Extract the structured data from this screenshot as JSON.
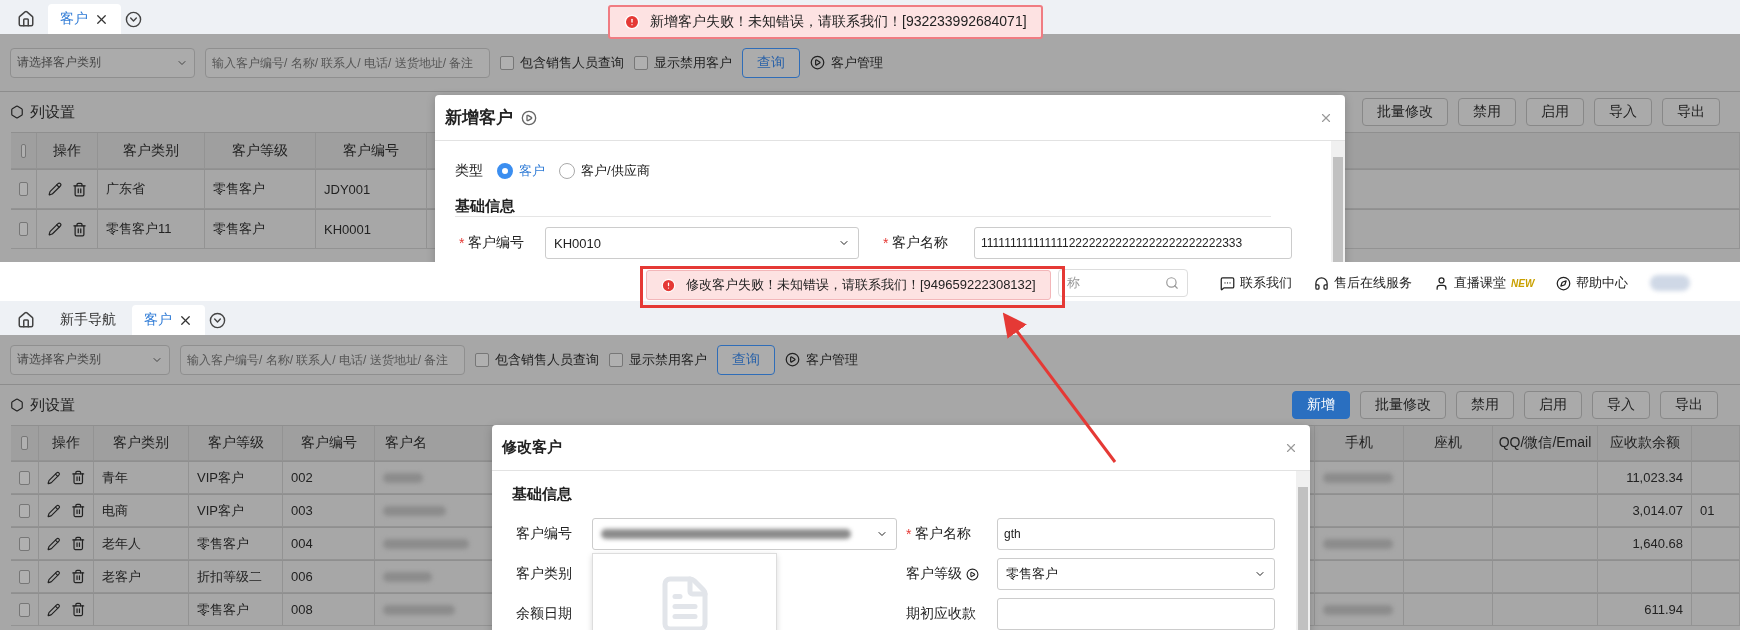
{
  "top_screen": {
    "tabs": [
      {
        "label": "客户",
        "selected": true,
        "closable": true
      }
    ],
    "toast": {
      "message": "新增客户失败！未知错误，请联系我们！[932233992684071]"
    },
    "filter": {
      "category_placeholder": "请选择客户类别",
      "search_placeholder": "输入客户编号/ 名称/ 联系人/ 电话/ 送货地址/ 备注",
      "checkboxes": [
        {
          "label": "包含销售人员查询",
          "checked": false
        },
        {
          "label": "显示禁用客户",
          "checked": false
        }
      ],
      "query_button": "查询",
      "manage_link": "客户管理"
    },
    "column_settings": "列设置",
    "actions": [
      {
        "label": "批量修改",
        "primary": false
      },
      {
        "label": "禁用",
        "primary": false
      },
      {
        "label": "启用",
        "primary": false
      },
      {
        "label": "导入",
        "primary": false
      },
      {
        "label": "导出",
        "primary": false
      }
    ],
    "table": {
      "select_all_checked": false,
      "columns": [
        "操作",
        "客户类别",
        "客户等级",
        "客户编号"
      ],
      "rows": [
        {
          "checked": false,
          "category": "广东省",
          "level": "零售客户",
          "code": "JDY001"
        },
        {
          "checked": false,
          "category": "零售客户11",
          "level": "零售客户",
          "code": "KH0001"
        }
      ]
    },
    "dialog": {
      "title": "新增客户",
      "type_label": "类型",
      "type_options": [
        {
          "label": "客户",
          "selected": true
        },
        {
          "label": "客户/供应商",
          "selected": false
        }
      ],
      "section": "基础信息",
      "fields": [
        {
          "label": "客户编号",
          "required_mark": "*",
          "kind": "select",
          "value": "KH0010"
        },
        {
          "label": "客户名称",
          "required_mark": "*",
          "kind": "input",
          "value": "11111111111111122222222222222222222222333"
        }
      ]
    }
  },
  "bottom_screen": {
    "header": {
      "search_placeholder": "称",
      "links": [
        {
          "label": "联系我们"
        },
        {
          "label": "售后在线服务"
        },
        {
          "label": "直播课堂",
          "badge": "NEW"
        },
        {
          "label": "帮助中心"
        }
      ]
    },
    "tabs": [
      {
        "label": "新手导航",
        "selected": false,
        "closable": false
      },
      {
        "label": "客户",
        "selected": true,
        "closable": true
      }
    ],
    "toast": {
      "message": "修改客户失败！未知错误，请联系我们！[949659222308132]"
    },
    "filter": {
      "category_placeholder": "请选择客户类别",
      "search_placeholder": "输入客户编号/ 名称/ 联系人/ 电话/ 送货地址/ 备注",
      "checkboxes": [
        {
          "label": "包含销售人员查询",
          "checked": false
        },
        {
          "label": "显示禁用客户",
          "checked": false
        }
      ],
      "query_button": "查询",
      "manage_link": "客户管理"
    },
    "column_settings": "列设置",
    "actions": [
      {
        "label": "新增",
        "primary": true
      },
      {
        "label": "批量修改",
        "primary": false
      },
      {
        "label": "禁用",
        "primary": false
      },
      {
        "label": "启用",
        "primary": false
      },
      {
        "label": "导入",
        "primary": false
      },
      {
        "label": "导出",
        "primary": false
      }
    ],
    "table": {
      "select_all_checked": false,
      "columns": [
        "操作",
        "客户类别",
        "客户等级",
        "客户编号",
        "客户名",
        "手机",
        "座机",
        "QQ/微信/Email",
        "应收款余额"
      ],
      "rows": [
        {
          "checked": false,
          "category": "青年",
          "level": "VIP客户",
          "code": "002",
          "balance": "11,023.34"
        },
        {
          "checked": false,
          "category": "电商",
          "level": "VIP客户",
          "code": "003",
          "balance": "3,014.07",
          "column_10": "01"
        },
        {
          "checked": false,
          "category": "老年人",
          "level": "零售客户",
          "code": "004",
          "balance": "1,640.68"
        },
        {
          "checked": false,
          "category": "老客户",
          "level": "折扣等级二",
          "code": "006"
        },
        {
          "checked": false,
          "level": "零售客户",
          "code": "008",
          "balance": "611.94"
        }
      ]
    },
    "dialog": {
      "title": "修改客户",
      "section": "基础信息",
      "left_fields": [
        {
          "label": "客户编号",
          "kind": "select"
        },
        {
          "label": "客户类别",
          "kind": "dropdown"
        },
        {
          "label": "余额日期",
          "kind": "plain"
        }
      ],
      "right_fields": [
        {
          "label": "客户名称",
          "required_mark": "*",
          "kind": "input",
          "value": "gth"
        },
        {
          "label": "客户等级",
          "kind": "select",
          "value": "零售客户",
          "info": true
        },
        {
          "label": "期初应收款",
          "kind": "input"
        }
      ]
    }
  }
}
